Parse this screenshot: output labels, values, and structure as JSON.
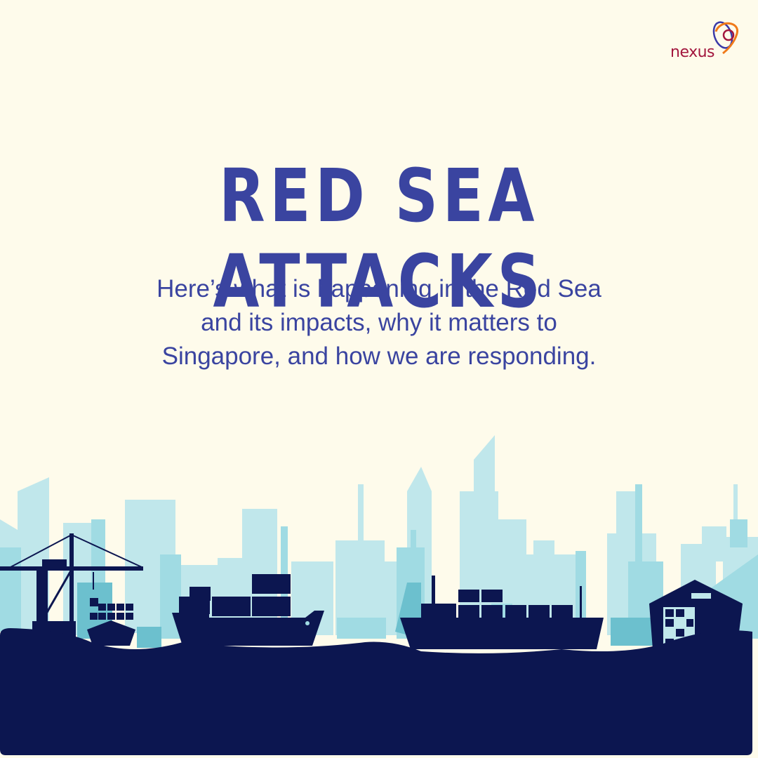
{
  "brand": {
    "name": "nexus",
    "colors": {
      "blue": "#3b3aa8",
      "orange": "#f07a1a",
      "red": "#a3173e"
    }
  },
  "title": "RED SEA ATTACKS",
  "subtitle": {
    "lines": [
      "Here’s what is happening in the Red Sea",
      "and its impacts, why it matters to",
      "Singapore, and how we are responding."
    ]
  },
  "colors": {
    "background": "#fefbeb",
    "text": "#3a44a0",
    "navy": "#0c1650",
    "skyline_light": "#c0e7eb",
    "skyline_mid": "#a0dbe3",
    "skyline_dark": "#6cc0ce"
  }
}
